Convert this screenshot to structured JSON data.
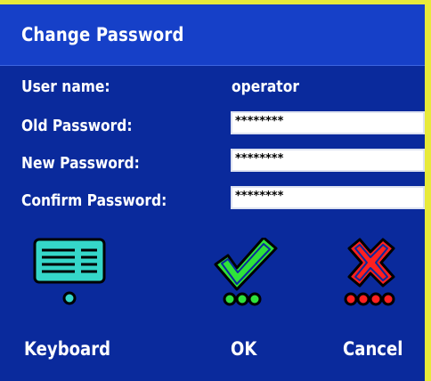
{
  "dialog": {
    "title": "Change Password"
  },
  "fields": {
    "username_label": "User name:",
    "username_value": "operator",
    "old_password_label": "Old Password:",
    "old_password_value": "********",
    "new_password_label": "New Password:",
    "new_password_value": "********",
    "confirm_password_label": "Confirm Password:",
    "confirm_password_value": "********"
  },
  "actions": {
    "keyboard_label": "Keyboard",
    "ok_label": "OK",
    "cancel_label": "Cancel",
    "keyboard_icon": "keyboard-icon",
    "ok_icon": "checkmark-icon",
    "cancel_icon": "x-icon"
  },
  "colors": {
    "background": "#0a2a9c",
    "title_bar": "#1640c8",
    "frame": "#e8ea3a",
    "keyboard_accent": "#35d7c9",
    "ok_accent": "#2fe23a",
    "cancel_accent": "#ff2020"
  }
}
